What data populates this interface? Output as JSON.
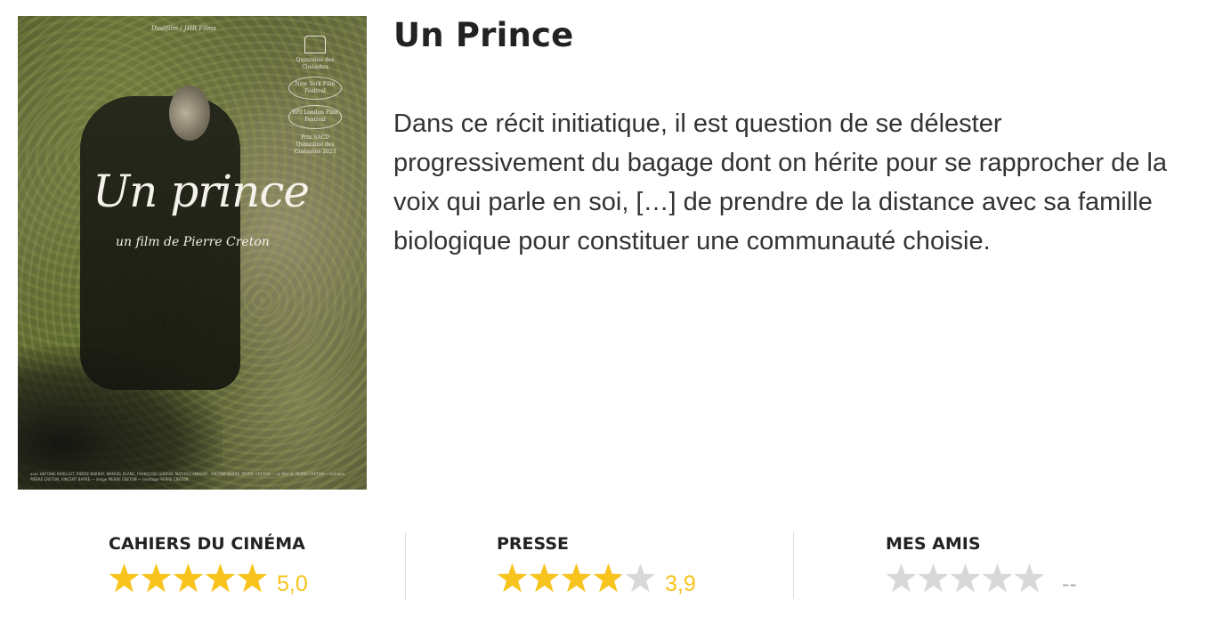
{
  "poster": {
    "top_credit": "Dualfilm / JHR Films",
    "festivals": [
      "Quinzaine des Cinéastes",
      "New York Film Festival",
      "BFI London Film Festival",
      "Prix SACD",
      "Quinzaine des Cinéastes 2023"
    ],
    "title": "Un prince",
    "subtitle": "un film de Pierre Creton",
    "credits": "avec ANTOINE BARILLOT, PIERRE BARRAY, MANUEL BLANC, FRANÇOISE LEBRUN, MATHIEU AMALRIC, VINCENT BARRÉ, PIERRE CRETON — un film de PIERRE CRETON — scénario PIERRE CRETON, VINCENT BARRÉ — image PIERRE CRETON — montage PIERRE CRETON"
  },
  "movie": {
    "title": "Un Prince",
    "synopsis": "Dans ce récit initiatique, il est question de se délester progressivement du bagage dont on hérite pour se rapprocher de la voix qui parle en soi, […] de prendre de la distance avec sa famille biologique pour constituer une communauté choisie."
  },
  "ratings": [
    {
      "label": "CAHIERS DU CINÉMA",
      "stars_filled": 5.0,
      "score": "5,0"
    },
    {
      "label": "PRESSE",
      "stars_filled": 3.9,
      "score": "3,9"
    },
    {
      "label": "MES AMIS",
      "stars_filled": 0,
      "score": "--"
    }
  ],
  "colors": {
    "star_filled": "#f7c31c",
    "star_empty": "#d8d8d8",
    "score_empty": "#aaaaaa"
  }
}
